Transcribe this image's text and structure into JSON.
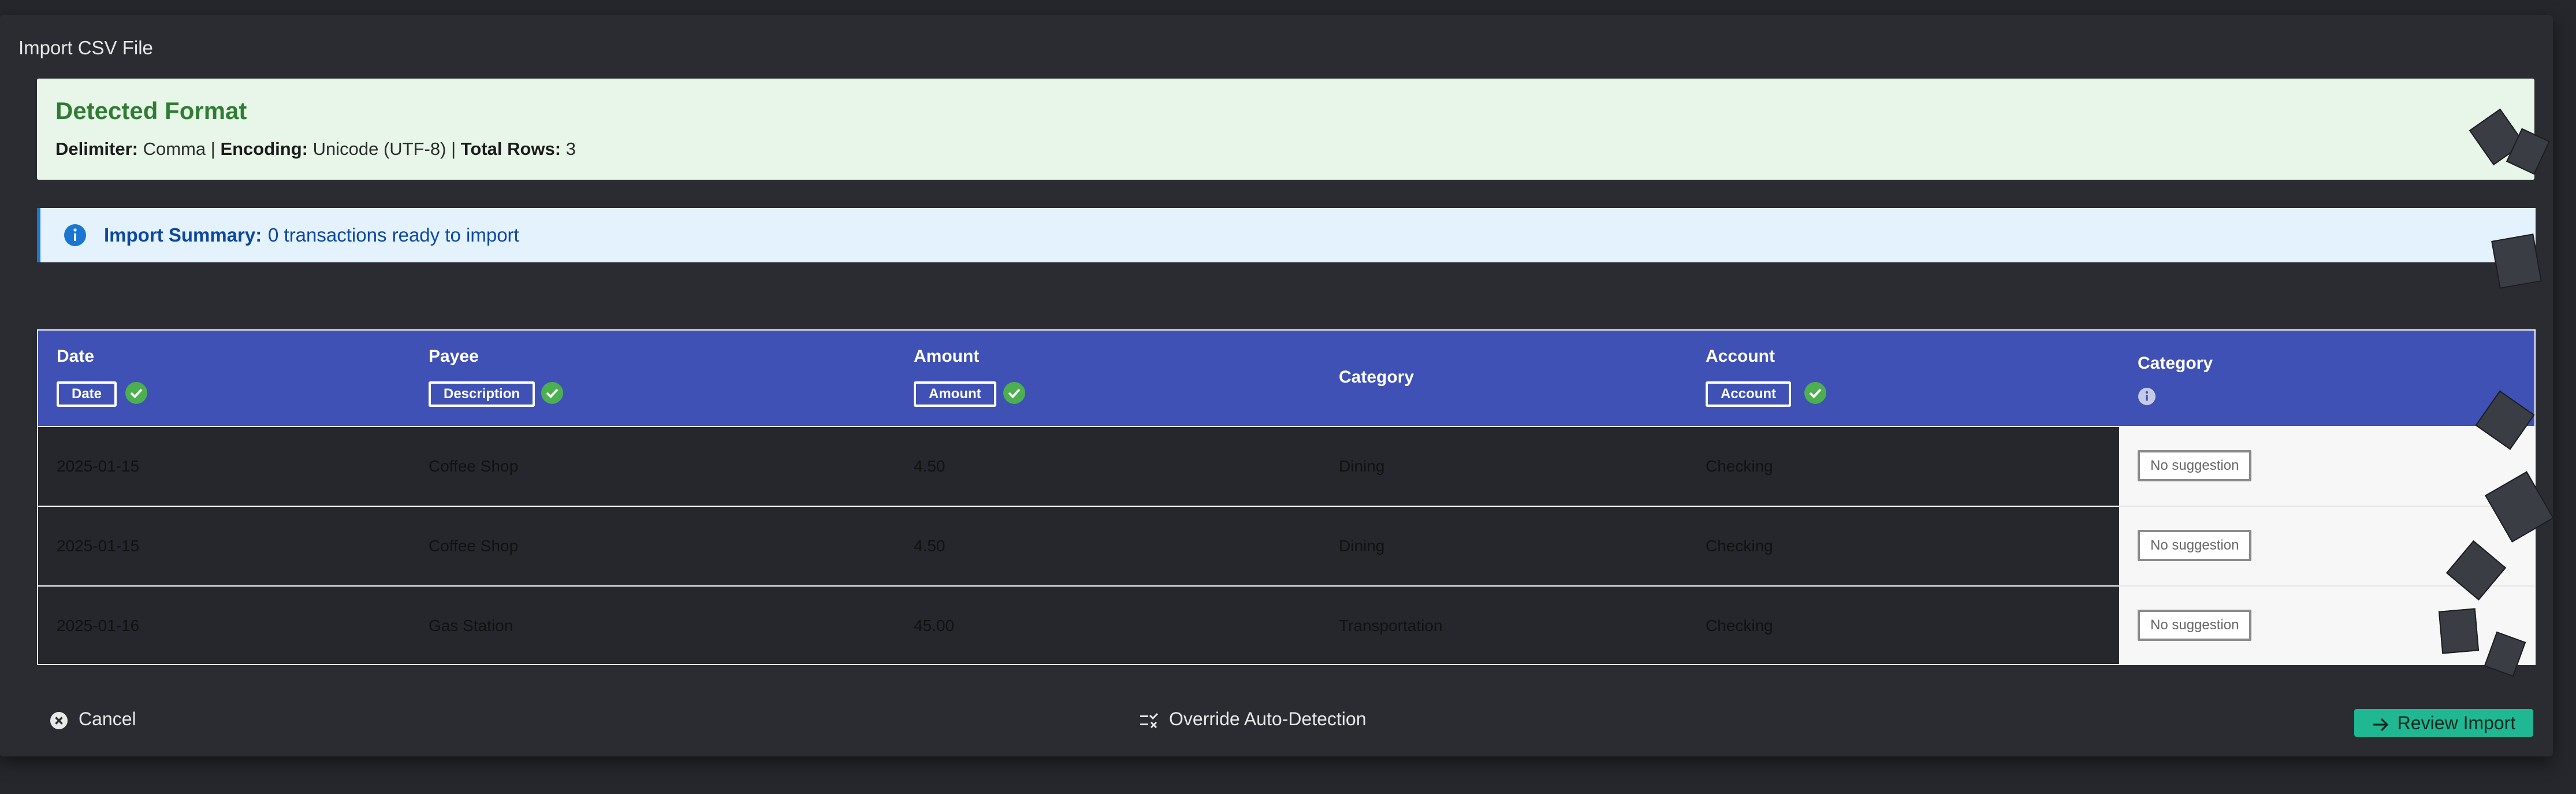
{
  "dialog": {
    "title": "Import CSV File"
  },
  "detected_format": {
    "title": "Detected Format",
    "delimiter_label": "Delimiter:",
    "delimiter_value": "Comma",
    "encoding_label": "Encoding:",
    "encoding_value": "Unicode (UTF-8)",
    "total_rows_label": "Total Rows:",
    "total_rows_value": "3",
    "separator": "|"
  },
  "summary": {
    "label": "Import Summary:",
    "text": "0 transactions ready to import",
    "icon": "info-icon"
  },
  "table": {
    "columns": [
      {
        "label": "Date",
        "tag": "Date",
        "status": "check"
      },
      {
        "label": "Payee",
        "tag": "Description",
        "status": "check"
      },
      {
        "label": "Amount",
        "tag": "Amount",
        "status": "check"
      },
      {
        "label": "Category",
        "tag": "",
        "status": ""
      },
      {
        "label": "Account",
        "tag": "Account",
        "status": "check"
      },
      {
        "label": "Category",
        "tag": "",
        "status": "info"
      }
    ],
    "rows": [
      {
        "date": "2025-01-15",
        "payee": "Coffee Shop",
        "amount": "4.50",
        "category": "Dining",
        "account": "Checking",
        "suggestion": "No suggestion"
      },
      {
        "date": "2025-01-15",
        "payee": "Coffee Shop",
        "amount": "4.50",
        "category": "Dining",
        "account": "Checking",
        "suggestion": "No suggestion"
      },
      {
        "date": "2025-01-16",
        "payee": "Gas Station",
        "amount": "45.00",
        "category": "Transportation",
        "account": "Checking",
        "suggestion": "No suggestion"
      }
    ]
  },
  "footer": {
    "cancel_label": "Cancel",
    "override_label": "Override Auto-Detection",
    "review_label": "Review Import"
  },
  "colors": {
    "header_bg": "#3f51b5",
    "format_bg": "#e8f5e9",
    "format_title": "#2e7d32",
    "summary_bg": "#e3f2fd",
    "summary_text": "#0d47a1",
    "check_green": "#4caf50",
    "primary_teal": "#1fb893"
  }
}
